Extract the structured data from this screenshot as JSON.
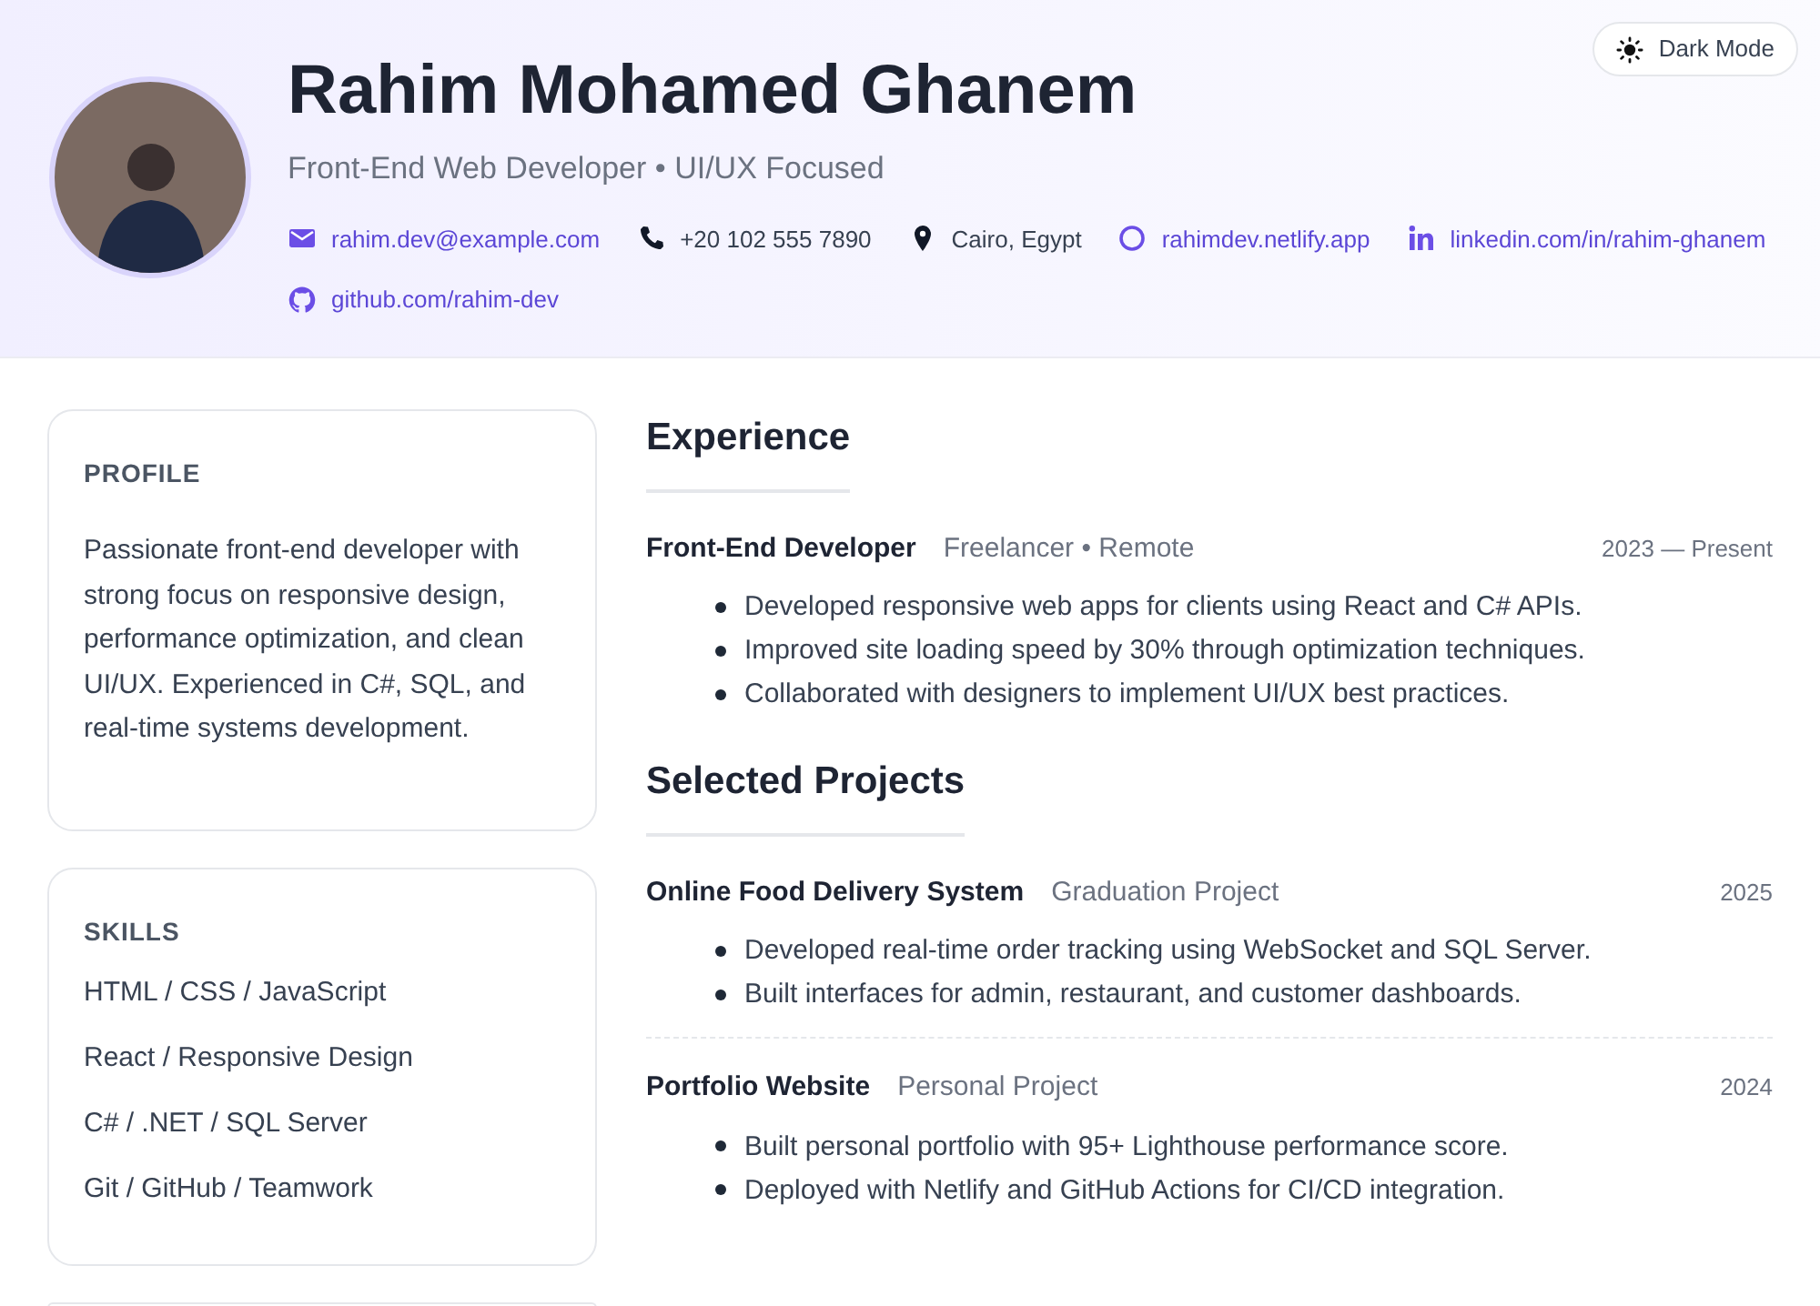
{
  "header": {
    "name": "Rahim Mohamed Ghanem",
    "title": "Front-End Web Developer • UI/UX Focused",
    "contacts": [
      {
        "kind": "email",
        "text": "rahim.dev@example.com",
        "link": true
      },
      {
        "kind": "phone",
        "text": "+20 102 555 7890",
        "link": false
      },
      {
        "kind": "location",
        "text": "Cairo, Egypt",
        "link": false
      },
      {
        "kind": "web",
        "text": "rahimdev.netlify.app",
        "link": true
      },
      {
        "kind": "linkedin",
        "text": "linkedin.com/in/rahim-ghanem",
        "link": true
      },
      {
        "kind": "github",
        "text": "github.com/rahim-dev",
        "link": true
      }
    ],
    "theme_toggle": {
      "label": "Dark Mode"
    }
  },
  "sidebar": {
    "profile": {
      "heading": "PROFILE",
      "text": "Passionate front-end developer with strong focus on responsive design, performance optimization, and clean UI/UX. Experienced in C#, SQL, and real-time systems development."
    },
    "skills": {
      "heading": "SKILLS",
      "items": [
        "HTML / CSS / JavaScript",
        "React / Responsive Design",
        "C# / .NET / SQL Server",
        "Git / GitHub / Teamwork"
      ]
    }
  },
  "sections": [
    {
      "heading": "Experience",
      "entries": [
        {
          "title": "Front-End Developer",
          "subtitle": "Freelancer • Remote",
          "date": "2023 — Present",
          "bullets": [
            "Developed responsive web apps for clients using React and C# APIs.",
            "Improved site loading speed by 30% through optimization techniques.",
            "Collaborated with designers to implement UI/UX best practices."
          ]
        }
      ]
    },
    {
      "heading": "Selected Projects",
      "entries": [
        {
          "title": "Online Food Delivery System",
          "subtitle": "Graduation Project",
          "date": "2025",
          "bullets": [
            "Developed real-time order tracking using WebSocket and SQL Server.",
            "Built interfaces for admin, restaurant, and customer dashboards."
          ]
        },
        {
          "title": "Portfolio Website",
          "subtitle": "Personal Project",
          "date": "2024",
          "bullets": [
            "Built personal portfolio with 95+ Lighthouse performance score.",
            "Deployed with Netlify and GitHub Actions for CI/CD integration."
          ]
        }
      ]
    }
  ]
}
